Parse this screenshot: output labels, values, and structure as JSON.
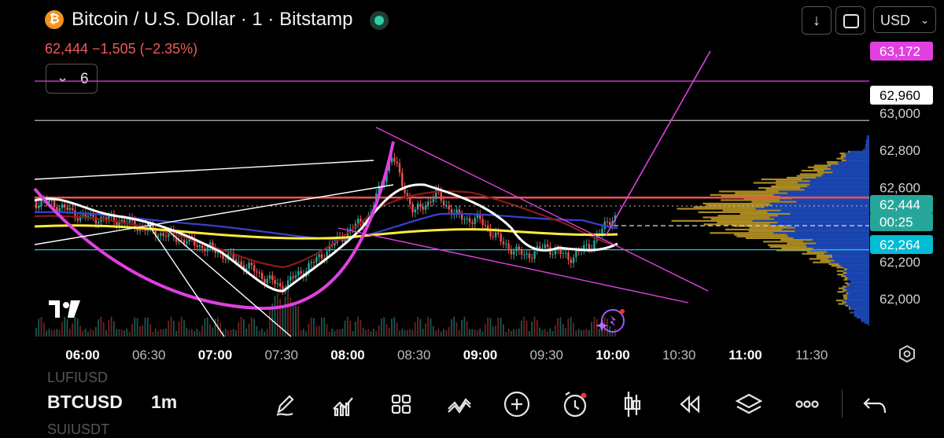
{
  "header": {
    "coin_glyph": "₿",
    "title": "Bitcoin / U.S. Dollar · 1 · Bitstamp",
    "price_line": "62,444  −1,505 (−2.35%)",
    "currency": "USD",
    "download_glyph": "↓",
    "indicator_count": "6",
    "chevron_glyph": "⌄"
  },
  "chart_data": {
    "type": "candlestick",
    "symbol": "BTCUSD",
    "interval": "1m",
    "exchange": "Bitstamp",
    "x_ticks": [
      "06:00",
      "06:30",
      "07:00",
      "07:30",
      "08:00",
      "08:30",
      "09:00",
      "09:30",
      "10:00",
      "10:30",
      "11:00",
      "11:30"
    ],
    "y_ticks": [
      62000,
      62200,
      62400,
      62600,
      62800,
      63000
    ],
    "y_tick_labels": [
      "62,000",
      "62,200",
      "62,600",
      "62,800",
      "63,000"
    ],
    "ylim": [
      61900,
      63200
    ],
    "price_labels": [
      {
        "text": "63,172",
        "value": 63172,
        "color": "#e040e0"
      },
      {
        "text": "62,960",
        "value": 62960,
        "color": "#ffffff"
      },
      {
        "text": "62,444",
        "value": 62444,
        "color": "#26a69a"
      },
      {
        "text": "00:25",
        "value": 62395,
        "color": "#26a69a"
      },
      {
        "text": "62,264",
        "value": 62264,
        "color": "#00bcd4"
      }
    ],
    "horizontal_lines": [
      {
        "value": 63172,
        "color": "#e040e0"
      },
      {
        "value": 62960,
        "color": "#cccccc"
      },
      {
        "value": 62545,
        "color": "#ef5350"
      },
      {
        "value": 62264,
        "color": "#26c6da"
      }
    ],
    "last_price": 62444,
    "change": -1505,
    "change_pct": -2.35,
    "candles_close_approx": [
      {
        "t": "05:45",
        "c": 62520
      },
      {
        "t": "06:00",
        "c": 62440
      },
      {
        "t": "06:15",
        "c": 62430
      },
      {
        "t": "06:30",
        "c": 62370
      },
      {
        "t": "06:45",
        "c": 62320
      },
      {
        "t": "07:00",
        "c": 62260
      },
      {
        "t": "07:15",
        "c": 62170
      },
      {
        "t": "07:30",
        "c": 62060
      },
      {
        "t": "07:45",
        "c": 62200
      },
      {
        "t": "08:00",
        "c": 62360
      },
      {
        "t": "08:10",
        "c": 62450
      },
      {
        "t": "08:20",
        "c": 62770
      },
      {
        "t": "08:30",
        "c": 62460
      },
      {
        "t": "08:40",
        "c": 62560
      },
      {
        "t": "08:50",
        "c": 62440
      },
      {
        "t": "09:00",
        "c": 62420
      },
      {
        "t": "09:10",
        "c": 62300
      },
      {
        "t": "09:20",
        "c": 62230
      },
      {
        "t": "09:30",
        "c": 62280
      },
      {
        "t": "09:40",
        "c": 62220
      },
      {
        "t": "09:50",
        "c": 62290
      },
      {
        "t": "10:00",
        "c": 62444
      }
    ]
  },
  "toolbar": {
    "symbol_prev": "LUFIUSD",
    "symbol": "BTCUSD",
    "timeframe": "1m",
    "symbol_next": "SUIUSDT",
    "tools": [
      "pencil-icon",
      "indicators-icon",
      "grid-icon",
      "patterns-icon",
      "add-icon",
      "alert-icon",
      "candles-icon",
      "replay-icon",
      "layers-icon",
      "more-icon"
    ]
  },
  "colors": {
    "background": "#000000",
    "up": "#26a69a",
    "down": "#ef5350",
    "magenta": "#e040e0",
    "yellow_ma": "#ffeb3b",
    "white_ma": "#ffffff",
    "volume_profile_blue": "#1e4fc8",
    "volume_profile_gold": "#c9a227"
  }
}
